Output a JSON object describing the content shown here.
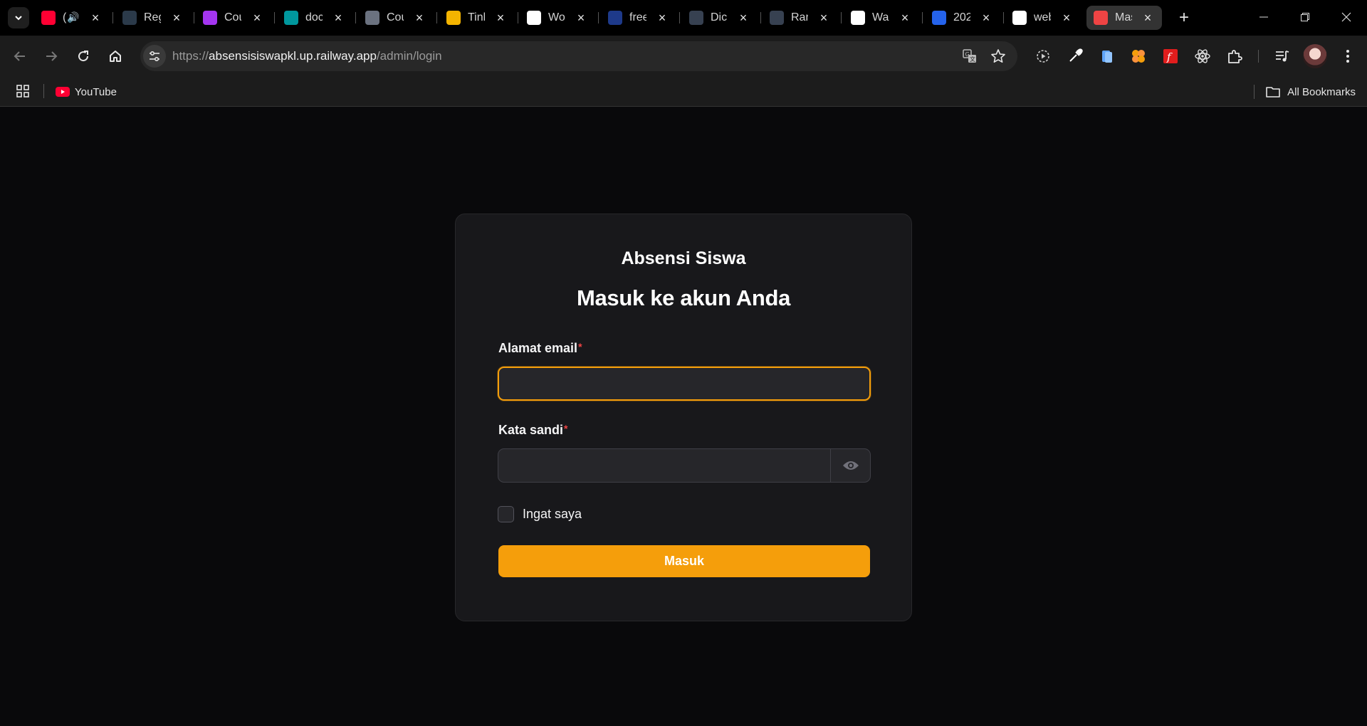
{
  "browser": {
    "tabs": [
      {
        "title": "(",
        "favicon": "youtube-icon",
        "color": "#ff0033",
        "audio": true
      },
      {
        "title": "Reg",
        "favicon": "sparkle-icon",
        "color": "#2b3a4a"
      },
      {
        "title": "Cou",
        "favicon": "udemy-icon",
        "color": "#a435f0"
      },
      {
        "title": "doc",
        "favicon": "arduino-icon",
        "color": "#00979d"
      },
      {
        "title": "Cou",
        "favicon": "globe-icon",
        "color": "#6b7280"
      },
      {
        "title": "Tink",
        "favicon": "tinkercad-icon",
        "color": "#f4b400"
      },
      {
        "title": "Wo",
        "favicon": "wikipedia-icon",
        "color": "#ffffff"
      },
      {
        "title": "free",
        "favicon": "lambda-icon",
        "color": "#1e3a8a"
      },
      {
        "title": "Dic",
        "favicon": "gamma-icon",
        "color": "#374151"
      },
      {
        "title": "Ran",
        "favicon": "gamma-icon",
        "color": "#374151"
      },
      {
        "title": "War",
        "favicon": "openai-icon",
        "color": "#ffffff"
      },
      {
        "title": "202",
        "favicon": "tiktok-alt-icon",
        "color": "#2563eb"
      },
      {
        "title": "web",
        "favicon": "circle-icon",
        "color": "#ffffff"
      },
      {
        "title": "Mas",
        "favicon": "laravel-icon",
        "color": "#ef4444",
        "active": true
      }
    ],
    "url_scheme": "https://",
    "url_host": "absensisiswapkl.up.railway.app",
    "url_path": "/admin/login",
    "bookmarks": [
      {
        "label": "YouTube",
        "icon": "youtube-icon"
      }
    ],
    "all_bookmarks_label": "All Bookmarks"
  },
  "login": {
    "brand": "Absensi Siswa",
    "heading": "Masuk ke akun Anda",
    "email_label": "Alamat email",
    "email_value": "",
    "password_label": "Kata sandi",
    "password_value": "",
    "required_mark": "*",
    "remember_label": "Ingat saya",
    "submit_label": "Masuk",
    "accent_color": "#f59e0b"
  }
}
